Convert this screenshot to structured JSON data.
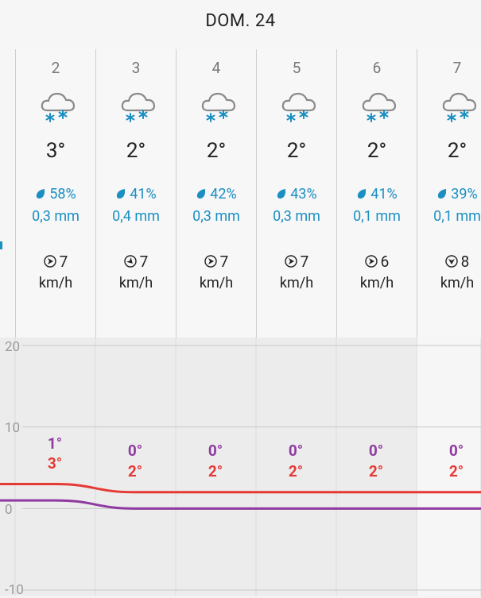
{
  "header": {
    "title": "DOM. 24"
  },
  "hours": [
    {
      "hour": "2",
      "temp": "3°",
      "humidity": "58%",
      "rain": "0,3 mm",
      "wind_speed": "7",
      "wind_unit": "km/h",
      "wind_icon": "wind-direction-icon"
    },
    {
      "hour": "3",
      "temp": "2°",
      "humidity": "41%",
      "rain": "0,4 mm",
      "wind_speed": "7",
      "wind_unit": "km/h",
      "wind_icon": "wind-direction-icon"
    },
    {
      "hour": "4",
      "temp": "2°",
      "humidity": "42%",
      "rain": "0,3 mm",
      "wind_speed": "7",
      "wind_unit": "km/h",
      "wind_icon": "wind-direction-icon"
    },
    {
      "hour": "5",
      "temp": "2°",
      "humidity": "43%",
      "rain": "0,3 mm",
      "wind_speed": "7",
      "wind_unit": "km/h",
      "wind_icon": "wind-direction-icon"
    },
    {
      "hour": "6",
      "temp": "2°",
      "humidity": "41%",
      "rain": "0,1 mm",
      "wind_speed": "6",
      "wind_unit": "km/h",
      "wind_icon": "wind-direction-icon"
    },
    {
      "hour": "7",
      "temp": "2°",
      "humidity": "39%",
      "rain": "0,1 mm",
      "wind_speed": "8",
      "wind_unit": "km/h",
      "wind_icon": "wind-direction-icon"
    }
  ],
  "weather_icon": "snow-cloud-icon",
  "colors": {
    "rain": "#1b8fc2",
    "max_line": "#e53935",
    "min_line": "#8f3aa0"
  },
  "chart_data": {
    "type": "line",
    "x": [
      "2",
      "3",
      "4",
      "5",
      "6",
      "7"
    ],
    "series": [
      {
        "name": "max",
        "values": [
          3,
          2,
          2,
          2,
          2,
          2
        ],
        "labels": [
          "3°",
          "2°",
          "2°",
          "2°",
          "2°",
          "2°"
        ]
      },
      {
        "name": "min",
        "values": [
          1,
          0,
          0,
          0,
          0,
          0
        ],
        "labels": [
          "1°",
          "0°",
          "0°",
          "0°",
          "0°",
          "0°"
        ]
      }
    ],
    "yticks": [
      "20",
      "10",
      "0",
      "-10"
    ],
    "ylim": [
      -10,
      20
    ],
    "grid": true
  }
}
